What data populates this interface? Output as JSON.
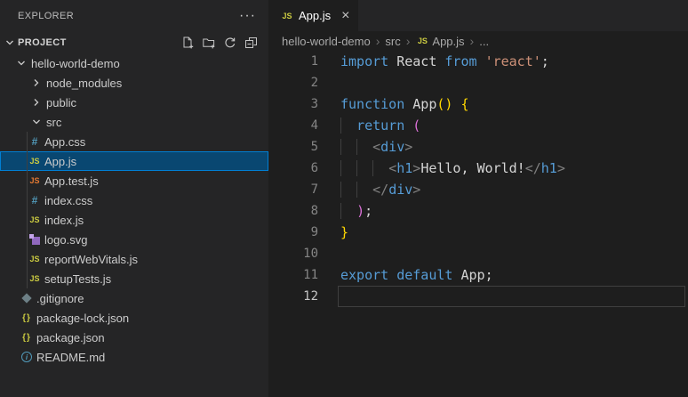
{
  "explorer": {
    "title": "EXPLORER",
    "menu_dots": "···",
    "section": "PROJECT",
    "actions": [
      {
        "name": "new-file"
      },
      {
        "name": "new-folder"
      },
      {
        "name": "refresh"
      },
      {
        "name": "collapse-all"
      }
    ],
    "tree": [
      {
        "label": "hello-world-demo",
        "kind": "folder",
        "expanded": true,
        "level": 1
      },
      {
        "label": "node_modules",
        "kind": "folder",
        "expanded": false,
        "level": 2
      },
      {
        "label": "public",
        "kind": "folder",
        "expanded": false,
        "level": 2
      },
      {
        "label": "src",
        "kind": "folder",
        "expanded": true,
        "level": 2
      },
      {
        "label": "App.css",
        "kind": "file",
        "icon": "css",
        "level": 3
      },
      {
        "label": "App.js",
        "kind": "file",
        "icon": "js",
        "level": 3,
        "selected": true
      },
      {
        "label": "App.test.js",
        "kind": "file",
        "icon": "js-test",
        "level": 3
      },
      {
        "label": "index.css",
        "kind": "file",
        "icon": "css",
        "level": 3
      },
      {
        "label": "index.js",
        "kind": "file",
        "icon": "js",
        "level": 3
      },
      {
        "label": "logo.svg",
        "kind": "file",
        "icon": "svg",
        "level": 3
      },
      {
        "label": "reportWebVitals.js",
        "kind": "file",
        "icon": "js",
        "level": 3
      },
      {
        "label": "setupTests.js",
        "kind": "file",
        "icon": "js",
        "level": 3
      },
      {
        "label": ".gitignore",
        "kind": "file",
        "icon": "git",
        "level": 2
      },
      {
        "label": "package-lock.json",
        "kind": "file",
        "icon": "json",
        "level": 2
      },
      {
        "label": "package.json",
        "kind": "file",
        "icon": "json",
        "level": 2
      },
      {
        "label": "README.md",
        "kind": "file",
        "icon": "info",
        "level": 2
      }
    ]
  },
  "tab": {
    "label": "App.js",
    "icon": "js",
    "close": "×"
  },
  "breadcrumb": {
    "items": [
      {
        "label": "hello-world-demo"
      },
      {
        "label": "src"
      },
      {
        "label": "App.js",
        "icon": "js"
      },
      {
        "label": "..."
      }
    ],
    "separator": "›"
  },
  "editor": {
    "lines": [
      {
        "num": "1",
        "tokens": [
          [
            "kw",
            "import"
          ],
          [
            "pl",
            " "
          ],
          [
            "id",
            "React"
          ],
          [
            "pl",
            " "
          ],
          [
            "kw",
            "from"
          ],
          [
            "pl",
            " "
          ],
          [
            "str",
            "'react'"
          ],
          [
            "pl",
            ";"
          ]
        ]
      },
      {
        "num": "2",
        "tokens": []
      },
      {
        "num": "3",
        "tokens": [
          [
            "kw",
            "function"
          ],
          [
            "pl",
            " "
          ],
          [
            "id",
            "App"
          ],
          [
            "b1",
            "()"
          ],
          [
            "pl",
            " "
          ],
          [
            "b1",
            "{"
          ]
        ]
      },
      {
        "num": "4",
        "tokens": [
          [
            "ig",
            "  "
          ],
          [
            "kw",
            "return"
          ],
          [
            "pl",
            " "
          ],
          [
            "b2",
            "("
          ]
        ]
      },
      {
        "num": "5",
        "tokens": [
          [
            "ig",
            "  "
          ],
          [
            "ig",
            "  "
          ],
          [
            "ab",
            "<"
          ],
          [
            "tag",
            "div"
          ],
          [
            "ab",
            ">"
          ]
        ]
      },
      {
        "num": "6",
        "tokens": [
          [
            "ig",
            "  "
          ],
          [
            "ig",
            "  "
          ],
          [
            "ig",
            "  "
          ],
          [
            "ab",
            "<"
          ],
          [
            "tag",
            "h1"
          ],
          [
            "ab",
            ">"
          ],
          [
            "tx",
            "Hello, World!"
          ],
          [
            "ab",
            "</"
          ],
          [
            "tag",
            "h1"
          ],
          [
            "ab",
            ">"
          ]
        ]
      },
      {
        "num": "7",
        "tokens": [
          [
            "ig",
            "  "
          ],
          [
            "ig",
            "  "
          ],
          [
            "ab",
            "</"
          ],
          [
            "tag",
            "div"
          ],
          [
            "ab",
            ">"
          ]
        ]
      },
      {
        "num": "8",
        "tokens": [
          [
            "ig",
            "  "
          ],
          [
            "b2",
            ")"
          ],
          [
            "pl",
            ";"
          ]
        ]
      },
      {
        "num": "9",
        "tokens": [
          [
            "b1",
            "}"
          ]
        ]
      },
      {
        "num": "10",
        "tokens": []
      },
      {
        "num": "11",
        "tokens": [
          [
            "kw",
            "export"
          ],
          [
            "pl",
            " "
          ],
          [
            "kw",
            "default"
          ],
          [
            "pl",
            " "
          ],
          [
            "id",
            "App"
          ],
          [
            "pl",
            ";"
          ]
        ]
      },
      {
        "num": "12",
        "tokens": [],
        "current": true
      }
    ]
  },
  "colors": {
    "sidebar_bg": "#252526",
    "editor_bg": "#1e1e1e",
    "selection_bg": "#094771",
    "selection_border": "#007fd4",
    "keyword": "#569cd6",
    "string": "#ce9178",
    "bracket_level1": "#ffd700",
    "bracket_level2": "#da70d6",
    "jsx_tag": "#569cd6",
    "jsx_punctuation": "#808080",
    "js_icon": "#cbcb41",
    "js_test_icon": "#e37933",
    "css_icon": "#519aba",
    "svg_icon": "#9068be",
    "info_icon": "#519aba",
    "git_icon": "#6d8086"
  }
}
